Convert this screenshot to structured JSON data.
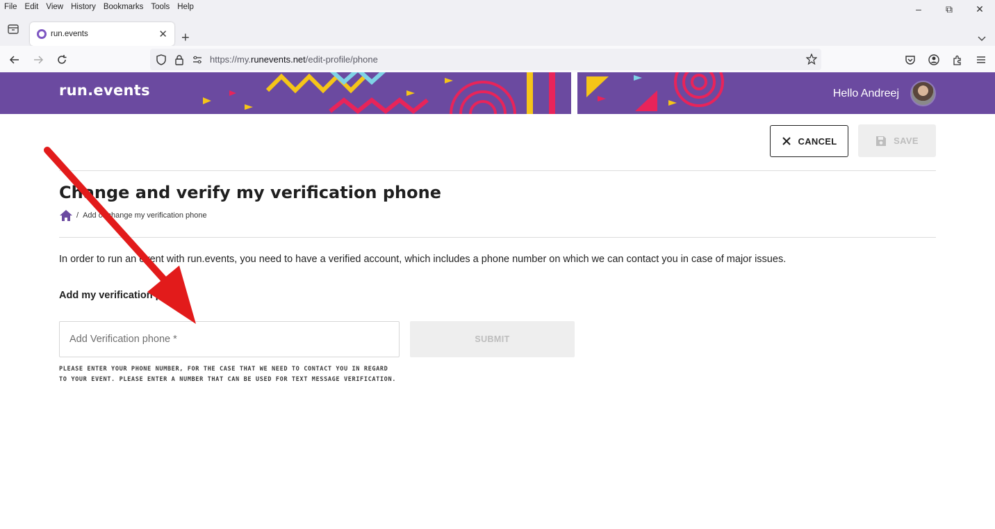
{
  "browser": {
    "menu": [
      "File",
      "Edit",
      "View",
      "History",
      "Bookmarks",
      "Tools",
      "Help"
    ],
    "tab_title": "run.events",
    "url_prefix": "https://my.",
    "url_domain": "runevents.net",
    "url_path": "/edit-profile/phone"
  },
  "header": {
    "logo": "run.events",
    "greeting": "Hello Andreej",
    "colors": {
      "brand": "#6b4aa0",
      "yellow": "#f5c518",
      "cyan": "#7fd3e6",
      "pink": "#e8245a"
    }
  },
  "toolbar": {
    "cancel_label": "CANCEL",
    "save_label": "SAVE"
  },
  "page": {
    "title": "Change and verify my verification phone",
    "breadcrumb": "Add or change my verification phone",
    "intro": "In order to run an event with run.events, you need to have a verified account, which includes a phone number on which we can contact you in case of major issues.",
    "section_label": "Add my verification phone",
    "phone_placeholder": "Add Verification phone *",
    "submit_label": "SUBMIT",
    "helper_text": "PLEASE ENTER YOUR PHONE NUMBER, FOR THE CASE THAT WE NEED TO CONTACT YOU IN REGARD TO YOUR EVENT. PLEASE ENTER A NUMBER THAT CAN BE USED FOR TEXT MESSAGE VERIFICATION."
  }
}
